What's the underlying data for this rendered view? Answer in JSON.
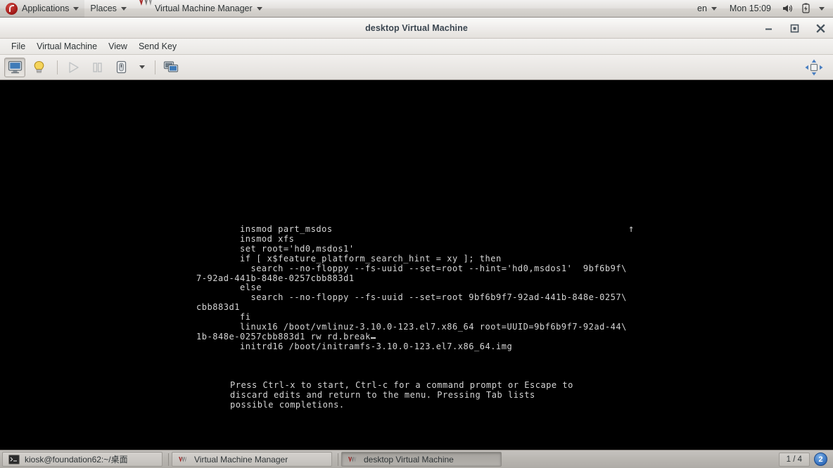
{
  "top_panel": {
    "logo_icon": "fedora-logo-icon",
    "applications_label": "Applications",
    "places_label": "Places",
    "window_menu_label": "Virtual Machine Manager",
    "window_menu_icon": "virt-manager-logo-icon",
    "keyboard_layout": "en",
    "clock": "Mon 15:09",
    "volume_icon": "speaker-icon",
    "battery_icon": "battery-icon",
    "system_menu_icon": "chevron-down-icon"
  },
  "window": {
    "title": "desktop Virtual Machine",
    "controls": {
      "minimize": "minimize-icon",
      "maximize": "maximize-icon",
      "close": "close-icon"
    },
    "menubar": [
      "File",
      "Virtual Machine",
      "View",
      "Send Key"
    ],
    "toolbar": {
      "console_view": "console-icon",
      "details_view": "lightbulb-icon",
      "run": "play-icon",
      "pause": "pause-icon",
      "shutdown": "power-icon",
      "shutdown_options": "chevron-down-icon",
      "snapshots": "snapshots-icon",
      "fullscreen": "fullscreen-icon"
    }
  },
  "console": {
    "scroll_indicator": "↑",
    "grub_text": "        insmod part_msdos\n        insmod xfs\n        set root='hd0,msdos1'\n        if [ x$feature_platform_search_hint = xy ]; then\n          search --no-floppy --fs-uuid --set=root --hint='hd0,msdos1'  9bf6b9f\\\n7-92ad-441b-848e-0257cbb883d1\n        else\n          search --no-floppy --fs-uuid --set=root 9bf6b9f7-92ad-441b-848e-0257\\\ncbb883d1\n        fi\n        linux16 /boot/vmlinuz-3.10.0-123.el7.x86_64 root=UUID=9bf6b9f7-92ad-44\\\n1b-848e-0257cbb883d1 rw rd.break",
    "help_text": "Press Ctrl-x to start, Ctrl-c for a command prompt or Escape to\ndiscard edits and return to the menu. Pressing Tab lists\npossible completions.",
    "initrd_line": "        initrd16 /boot/initramfs-3.10.0-123.el7.x86_64.img"
  },
  "taskbar": {
    "items": [
      {
        "label": "kiosk@foundation62:~/桌面",
        "icon": "terminal-icon",
        "active": false
      },
      {
        "label": "Virtual Machine Manager",
        "icon": "virt-manager-logo-icon",
        "active": false
      },
      {
        "label": "desktop Virtual Machine",
        "icon": "virt-manager-logo-icon",
        "active": true
      }
    ],
    "workspace": "1 / 4",
    "notification_count": "2"
  },
  "colors": {
    "panel_bg": "#e3e1de",
    "taskbar_bg": "#b9b6b1",
    "console_bg": "#000000",
    "console_fg": "#d6d6d6",
    "badge_blue": "#3b77c4"
  }
}
